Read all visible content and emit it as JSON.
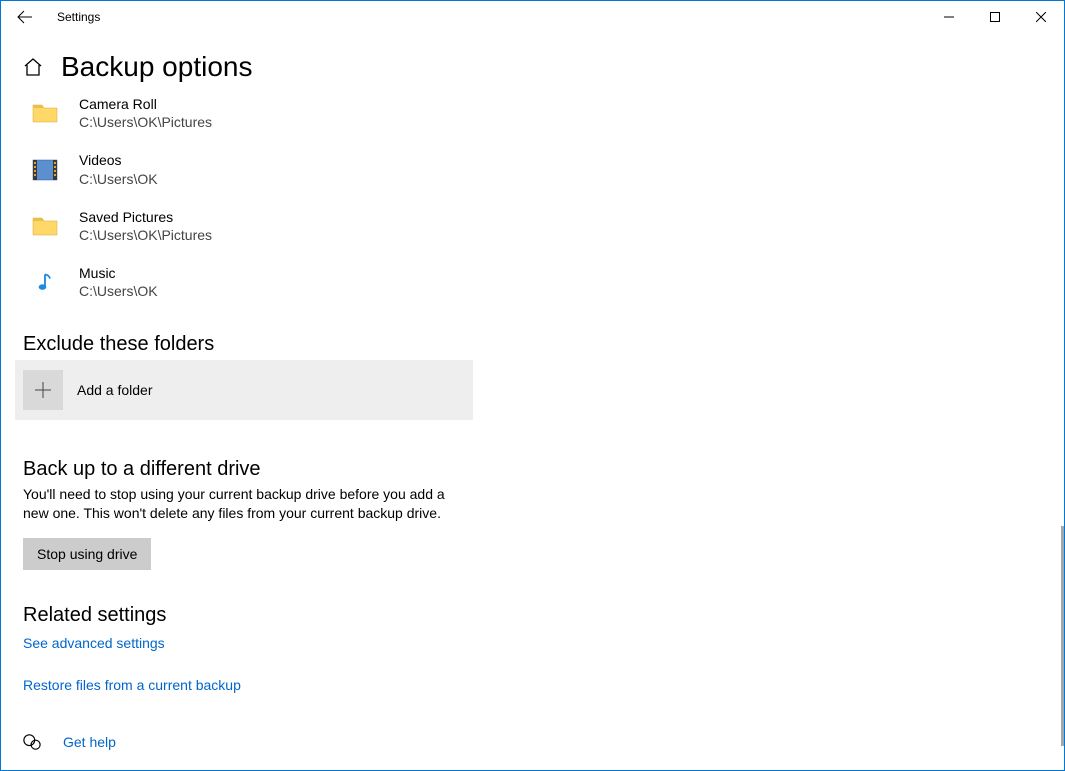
{
  "window": {
    "title": "Settings"
  },
  "page": {
    "title": "Backup options"
  },
  "folders": [
    {
      "name": "Camera Roll",
      "path": "C:\\Users\\OK\\Pictures",
      "icon": "folder"
    },
    {
      "name": "Videos",
      "path": "C:\\Users\\OK",
      "icon": "videos"
    },
    {
      "name": "Saved Pictures",
      "path": "C:\\Users\\OK\\Pictures",
      "icon": "folder"
    },
    {
      "name": "Music",
      "path": "C:\\Users\\OK",
      "icon": "music"
    }
  ],
  "exclude": {
    "heading": "Exclude these folders",
    "add_label": "Add a folder"
  },
  "different_drive": {
    "heading": "Back up to a different drive",
    "description": "You'll need to stop using your current backup drive before you add a new one. This won't delete any files from your current backup drive.",
    "button": "Stop using drive"
  },
  "related": {
    "heading": "Related settings",
    "advanced_link": "See advanced settings",
    "restore_link": "Restore files from a current backup"
  },
  "help": {
    "label": "Get help"
  }
}
